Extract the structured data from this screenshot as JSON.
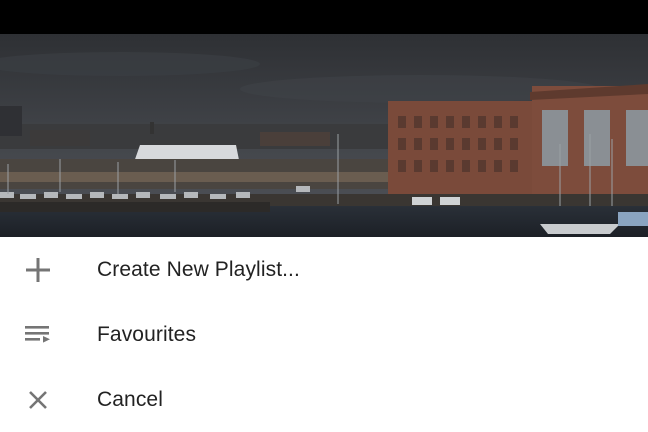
{
  "status_bar": {
    "color": "#000000"
  },
  "video": {
    "description_icon": "harbor-landscape-thumbnail"
  },
  "menu": {
    "items": [
      {
        "label": "Create New Playlist...",
        "icon": "plus-icon"
      },
      {
        "label": "Favourites",
        "icon": "playlist-icon"
      },
      {
        "label": "Cancel",
        "icon": "close-icon"
      }
    ]
  },
  "colors": {
    "icon": "#757575",
    "text": "#222222",
    "sheet": "#ffffff"
  }
}
